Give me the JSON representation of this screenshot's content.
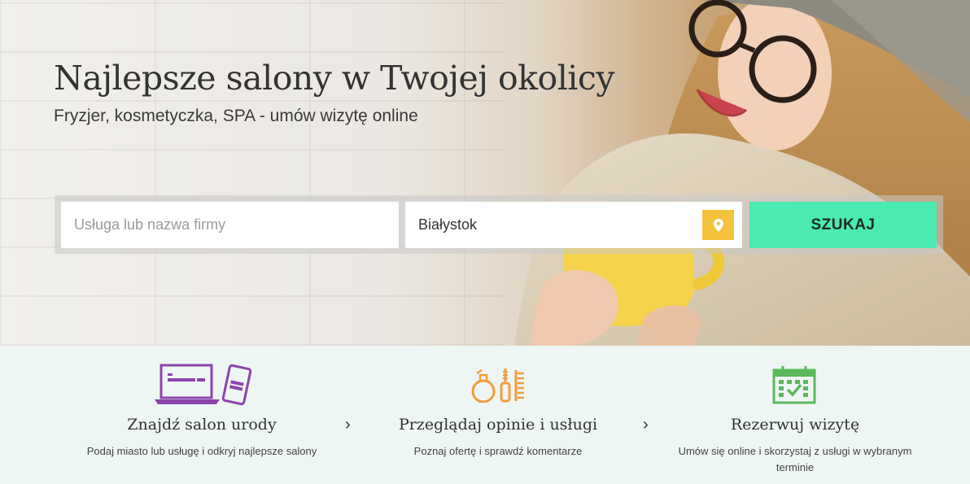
{
  "hero": {
    "title": "Najlepsze salony w Twojej okolicy",
    "subtitle": "Fryzjer, kosmetyczka, SPA - umów wizytę online"
  },
  "search": {
    "service_placeholder": "Usługa lub nazwa firmy",
    "city_value": "Białystok",
    "location_icon": "map-pin-icon",
    "button_label": "SZUKAJ"
  },
  "steps": [
    {
      "icon": "laptop-phone-icon",
      "title": "Znajdź salon urody",
      "description": "Podaj miasto lub usługę i odkryj najlepsze salony"
    },
    {
      "icon": "beauty-products-icon",
      "title": "Przeglądaj opinie i usługi",
      "description": "Poznaj ofertę i sprawdź komentarze"
    },
    {
      "icon": "calendar-check-icon",
      "title": "Rezerwuj wizytę",
      "description": "Umów się online i skorzystaj z usługi w wybranym terminie"
    }
  ],
  "colors": {
    "accent_button": "#4aeab1",
    "pin_button": "#f5c23c",
    "icon_purple": "#8e44ad",
    "icon_orange": "#f39c3c",
    "icon_green": "#5cb85c",
    "steps_background": "#eef6f3"
  }
}
